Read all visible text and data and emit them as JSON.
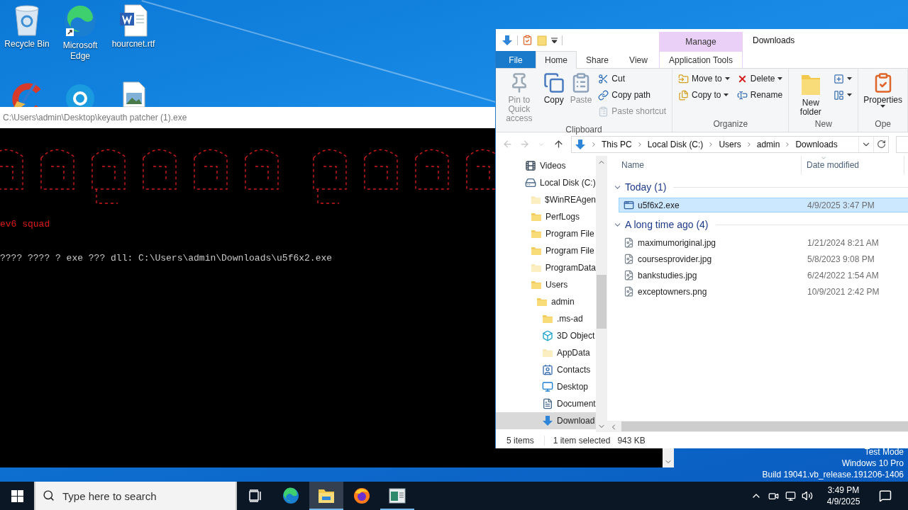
{
  "desktop": {
    "icons": [
      {
        "label": "Recycle Bin",
        "kind": "recycle-bin"
      },
      {
        "label": "Microsoft Edge",
        "kind": "edge"
      },
      {
        "label": "hourcnet.rtf",
        "kind": "word"
      }
    ],
    "partial_icons": [
      {
        "kind": "cleaner"
      },
      {
        "kind": "skype"
      },
      {
        "kind": "image-file"
      }
    ],
    "edition_text": [
      "Test Mode",
      "Windows 10 Pro",
      "Build 19041.vb_release.191206-1406"
    ]
  },
  "console": {
    "title": "C:\\Users\\admin\\Desktop\\keyauth patcher (1).exe",
    "lines": [
      {
        "text": "ev6 squad",
        "kind": "accent"
      },
      {
        "text": "???? ???? ? exe ??? dll: C:\\Users\\admin\\Downloads\\u5f6x2.exe",
        "kind": "plain"
      }
    ]
  },
  "explorer": {
    "context_header": "Manage",
    "title": "Downloads",
    "tabs": [
      {
        "label": "File",
        "kind": "file",
        "selected": false
      },
      {
        "label": "Home",
        "kind": "tab",
        "selected": true
      },
      {
        "label": "Share",
        "kind": "tab",
        "selected": false
      },
      {
        "label": "View",
        "kind": "tab",
        "selected": false
      },
      {
        "label": "Application Tools",
        "kind": "context",
        "selected": false
      }
    ],
    "ribbon": [
      {
        "label": "Clipboard",
        "items": [
          {
            "kind": "pin",
            "label": "Pin to Quick access",
            "disabled": true,
            "dropdown": false
          },
          {
            "kind": "copy",
            "label": "Copy",
            "disabled": false,
            "dropdown": false
          },
          {
            "kind": "paste",
            "label": "Paste",
            "disabled": true,
            "dropdown": false
          },
          {
            "commands": [
              {
                "label": "Cut",
                "kind": "cut",
                "disabled": false,
                "dropdown": false
              },
              {
                "label": "Copy path",
                "kind": "path",
                "disabled": false,
                "dropdown": false
              },
              {
                "label": "Paste shortcut",
                "kind": "shortcut",
                "disabled": true,
                "dropdown": false
              }
            ]
          }
        ]
      },
      {
        "label": "Organize",
        "items": [
          {
            "commands": [
              {
                "label": "Move to",
                "kind": "move",
                "disabled": false,
                "dropdown": true
              },
              {
                "label": "Copy to",
                "kind": "duplicate",
                "disabled": false,
                "dropdown": true
              }
            ]
          },
          {
            "commands": [
              {
                "label": "Delete",
                "kind": "delete",
                "disabled": false,
                "dropdown": true
              },
              {
                "label": "Rename",
                "kind": "rename",
                "disabled": false,
                "dropdown": false
              }
            ]
          }
        ]
      },
      {
        "label": "New",
        "items": [
          {
            "kind": "folder",
            "label": "New folder",
            "disabled": false,
            "dropdown": false
          },
          {
            "commands": [
              {
                "kind": "item",
                "disabled": false,
                "dropdown": true
              },
              {
                "kind": "access",
                "disabled": false,
                "dropdown": true
              }
            ]
          }
        ]
      },
      {
        "label": "Ope",
        "items": [
          {
            "kind": "properties",
            "label": "Properties",
            "disabled": false,
            "dropdown": true
          }
        ]
      }
    ],
    "path": [
      "This PC",
      "Local Disk (C:)",
      "Users",
      "admin",
      "Downloads"
    ],
    "nav": [
      {
        "label": "Videos",
        "kind": "videos",
        "selected": false
      },
      {
        "label": "Local Disk (C:)",
        "kind": "drive",
        "selected": false,
        "children": [
          {
            "label": "$WinREAgen",
            "kind": "hidden",
            "selected": false
          },
          {
            "label": "PerfLogs",
            "kind": "folder",
            "selected": false
          },
          {
            "label": "Program File",
            "kind": "folder",
            "selected": false
          },
          {
            "label": "Program File",
            "kind": "folder",
            "selected": false
          },
          {
            "label": "ProgramData",
            "kind": "hidden",
            "selected": false
          },
          {
            "label": "Users",
            "kind": "folder",
            "selected": false,
            "children": [
              {
                "label": "admin",
                "kind": "folder",
                "selected": false,
                "children": [
                  {
                    "label": ".ms-ad",
                    "kind": "folder",
                    "selected": false
                  },
                  {
                    "label": "3D Object",
                    "kind": "objects",
                    "selected": false
                  },
                  {
                    "label": "AppData",
                    "kind": "hidden",
                    "selected": false
                  },
                  {
                    "label": "Contacts",
                    "kind": "contacts",
                    "selected": false
                  },
                  {
                    "label": "Desktop",
                    "kind": "desktop",
                    "selected": false
                  },
                  {
                    "label": "Document",
                    "kind": "documents",
                    "selected": false
                  },
                  {
                    "label": "Download",
                    "kind": "downloads",
                    "selected": true
                  }
                ]
              }
            ]
          }
        ]
      }
    ],
    "columns": [
      "Name",
      "Date modified"
    ],
    "groups": [
      {
        "label": "Today (1)",
        "expanded": true,
        "files": [
          {
            "name": "u5f6x2.exe",
            "date": "4/9/2025 3:47 PM",
            "kind": "exe",
            "selected": true
          }
        ]
      },
      {
        "label": "A long time ago (4)",
        "expanded": true,
        "files": [
          {
            "name": "maximumoriginal.jpg",
            "date": "1/21/2024 8:21 AM",
            "kind": "image",
            "selected": false
          },
          {
            "name": "coursesprovider.jpg",
            "date": "5/8/2023 9:08 PM",
            "kind": "image",
            "selected": false
          },
          {
            "name": "bankstudies.jpg",
            "date": "6/24/2022 1:54 AM",
            "kind": "image",
            "selected": false
          },
          {
            "name": "exceptowners.png",
            "date": "10/9/2021 2:42 PM",
            "kind": "image",
            "selected": false
          }
        ]
      }
    ],
    "status": {
      "count": "5 items",
      "selection": "1 item selected",
      "size": "943 KB"
    }
  },
  "taskbar": {
    "search": {
      "placeholder": "Type here to search"
    },
    "apps": [
      {
        "kind": "taskview",
        "active": false,
        "running": false
      },
      {
        "kind": "edge",
        "active": false,
        "running": false
      },
      {
        "kind": "explorer",
        "active": true,
        "running": true
      },
      {
        "kind": "firefox",
        "active": false,
        "running": false
      },
      {
        "kind": "console",
        "active": false,
        "running": true
      }
    ],
    "time": "3:49 PM",
    "date": "4/9/2025"
  }
}
